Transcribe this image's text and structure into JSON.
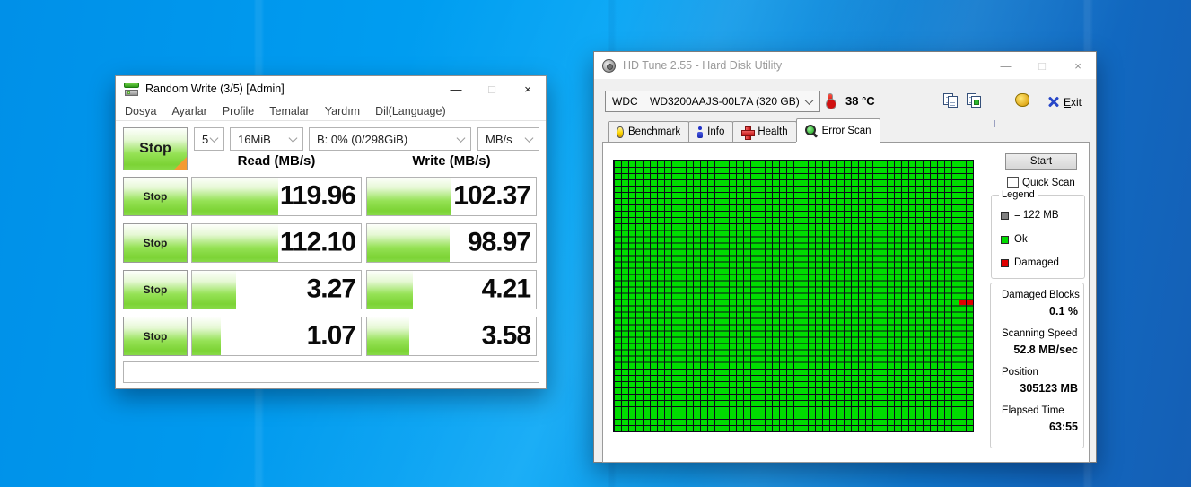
{
  "chrome": {
    "minimize": "—",
    "maximize": "□",
    "close": "×"
  },
  "cdm": {
    "title": "Random Write (3/5) [Admin]",
    "menu": [
      "Dosya",
      "Ayarlar",
      "Profile",
      "Temalar",
      "Yardım",
      "Dil(Language)"
    ],
    "stop_all_label": "Stop",
    "dropdowns": {
      "count": "5",
      "size": "16MiB",
      "drive": "B: 0% (0/298GiB)",
      "unit": "MB/s"
    },
    "read_header": "Read (MB/s)",
    "write_header": "Write (MB/s)",
    "rows": [
      {
        "button": "Stop",
        "read": "119.96",
        "read_fill": 51,
        "write": "102.37",
        "write_fill": 50
      },
      {
        "button": "Stop",
        "read": "112.10",
        "read_fill": 51,
        "write": "98.97",
        "write_fill": 49
      },
      {
        "button": "Stop",
        "read": "3.27",
        "read_fill": 26,
        "write": "4.21",
        "write_fill": 27
      },
      {
        "button": "Stop",
        "read": "1.07",
        "read_fill": 17,
        "write": "3.58",
        "write_fill": 25
      }
    ],
    "status_text": "",
    "bar_green": "#7cd335",
    "corner_orange": "#f49b32"
  },
  "hdtune": {
    "title": "HD Tune 2.55 - Hard Disk Utility",
    "drive_select": "WDC    WD3200AAJS-00L7A (320 GB)",
    "temperature": "38 °C",
    "exit_label": "Exit",
    "tabs": [
      {
        "label": "Benchmark"
      },
      {
        "label": "Info"
      },
      {
        "label": "Health"
      },
      {
        "label": "Error Scan"
      }
    ],
    "active_tab": "Error Scan",
    "scan": {
      "grid_cols": 50,
      "grid_rows": 43,
      "cell_color": "#00dc00",
      "line_color": "#0c0a1a",
      "damaged_color": "#e00000",
      "damaged_cells": [
        {
          "row": 22,
          "col": 48
        },
        {
          "row": 22,
          "col": 49
        }
      ]
    },
    "panel": {
      "start_label": "Start",
      "quick_scan_label": "Quick Scan",
      "legend": {
        "title": "Legend",
        "items": [
          {
            "color": "#808080",
            "label": "= 122 MB"
          },
          {
            "color": "#00dc00",
            "label": "Ok"
          },
          {
            "color": "#e00000",
            "label": "Damaged"
          }
        ]
      },
      "stats": [
        {
          "label": "Damaged Blocks",
          "value": "0.1 %"
        },
        {
          "label": "Scanning Speed",
          "value": "52.8 MB/sec"
        },
        {
          "label": "Position",
          "value": "305123 MB"
        },
        {
          "label": "Elapsed Time",
          "value": "63:55"
        }
      ]
    }
  }
}
